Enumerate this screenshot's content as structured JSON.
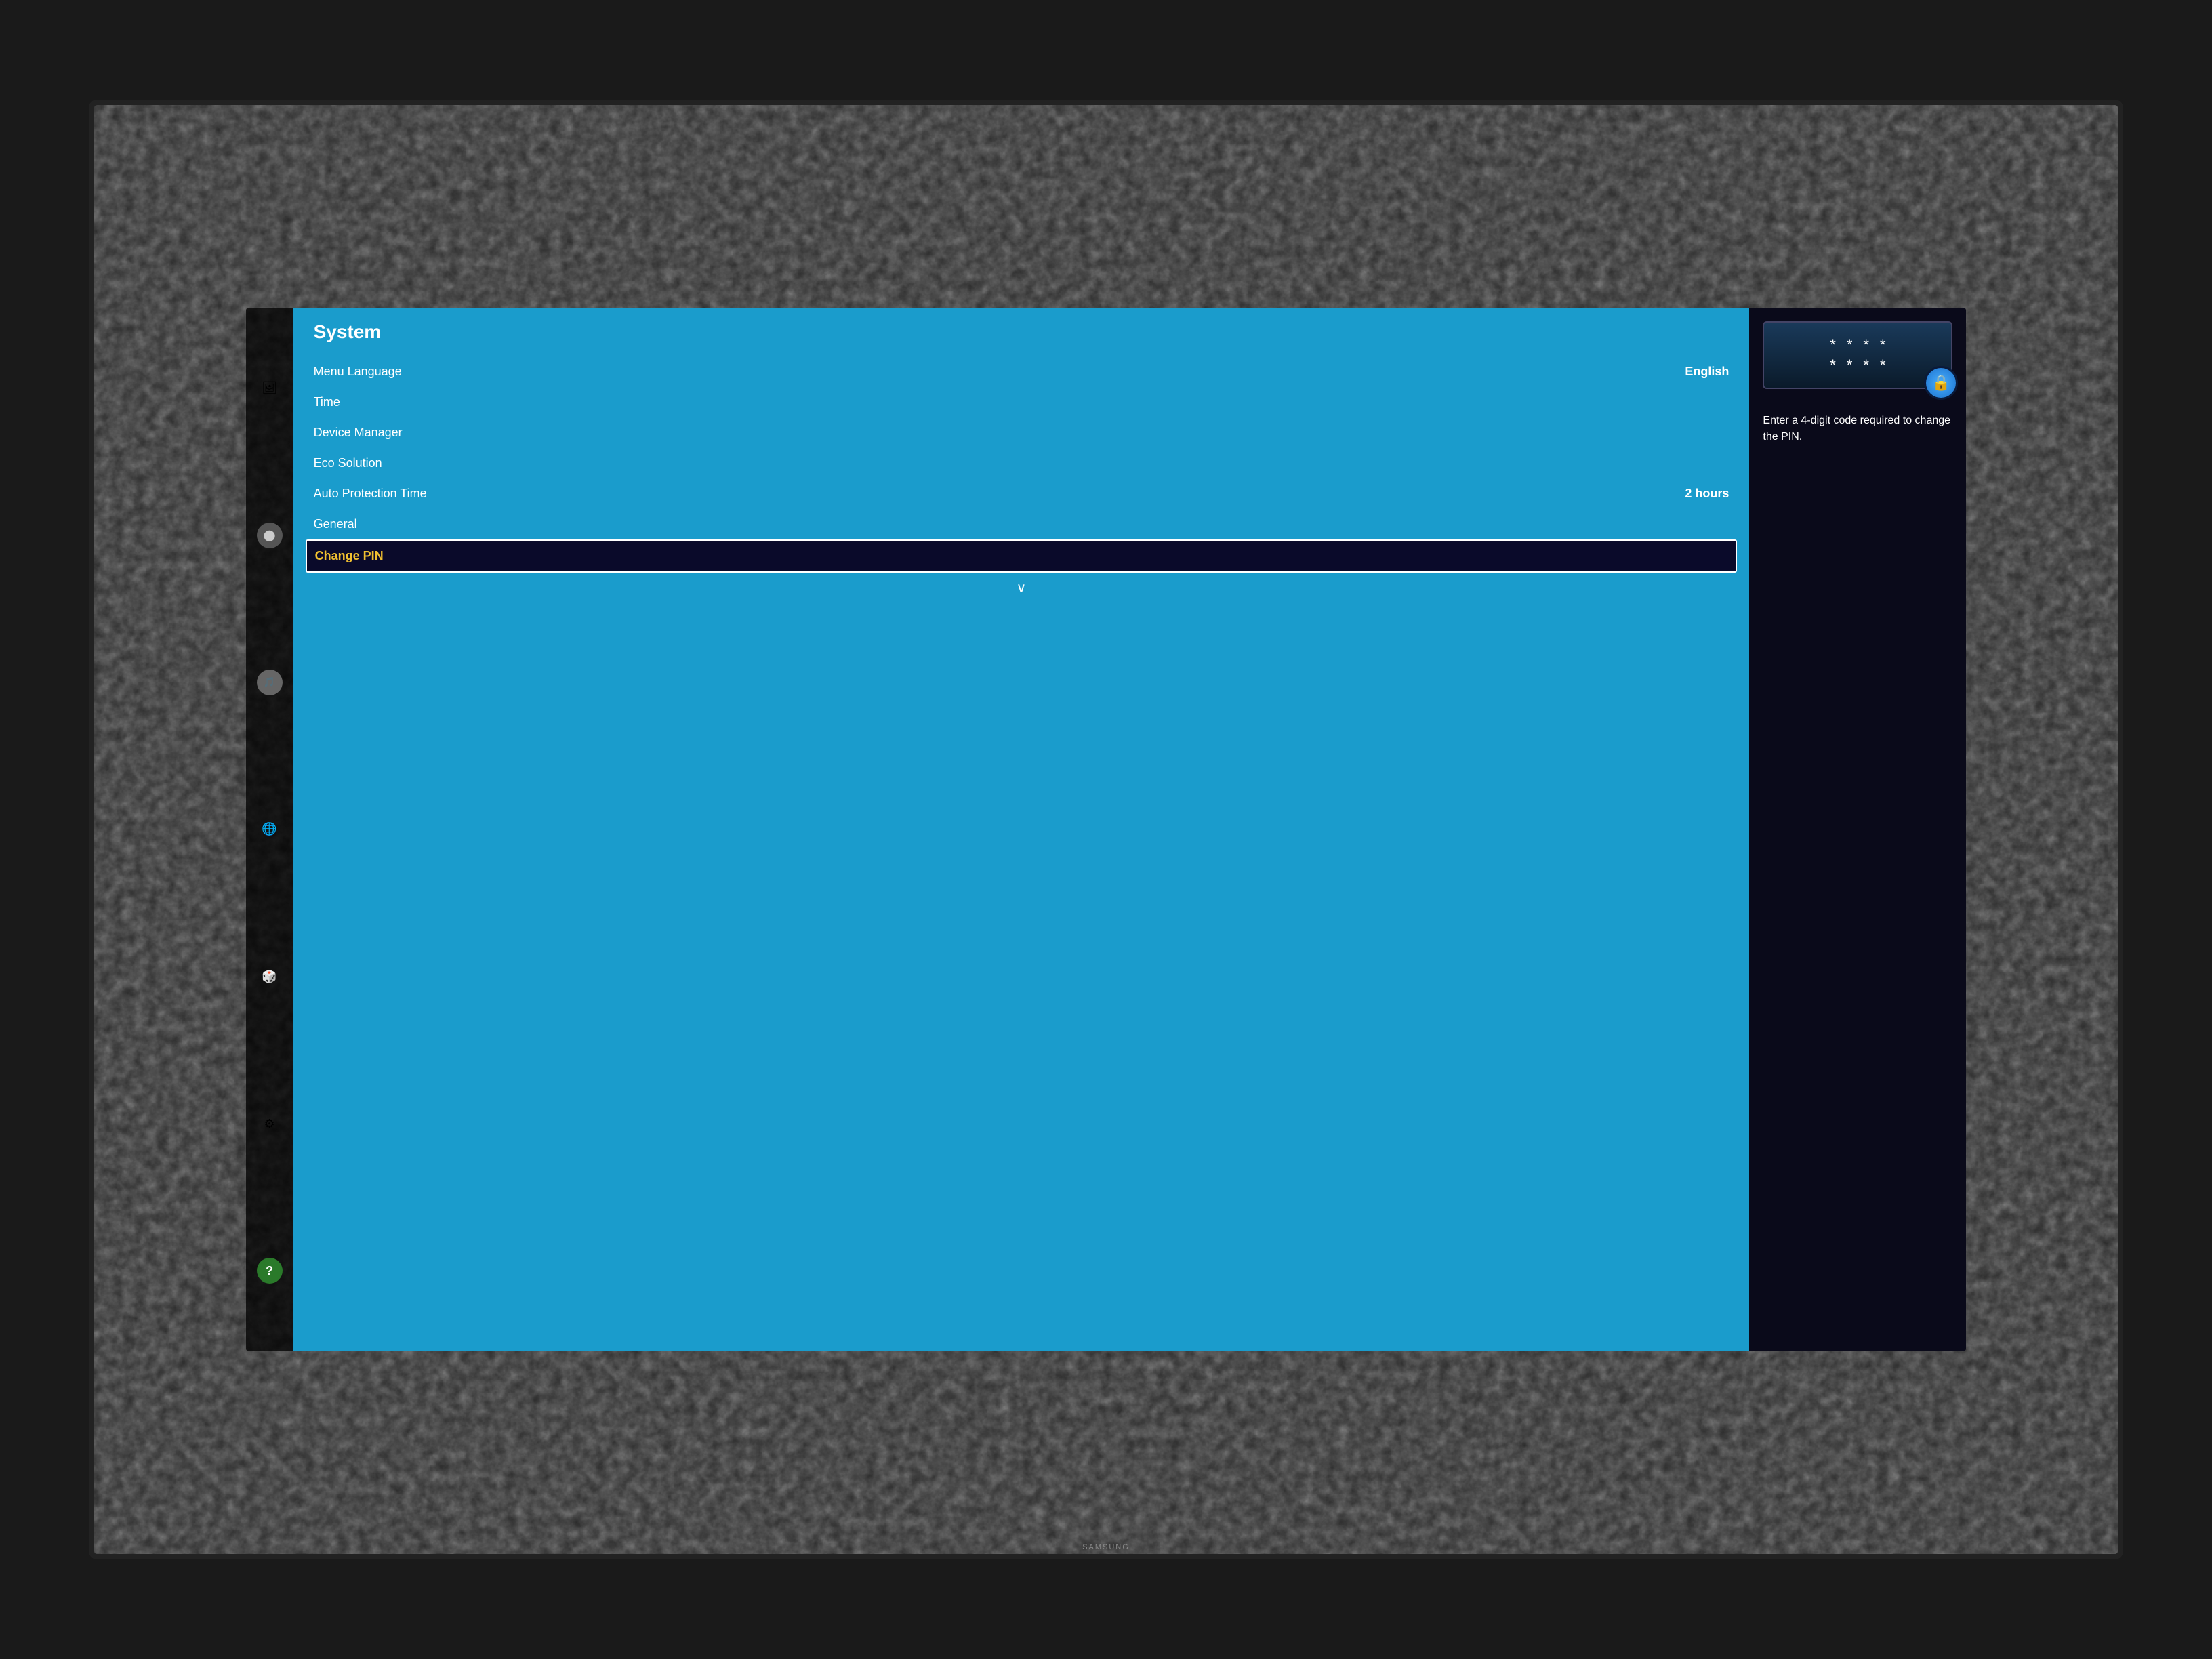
{
  "tv": {
    "brand": "SAMSUNG"
  },
  "sidebar": {
    "icons": [
      {
        "id": "photo-icon",
        "symbol": "🖼",
        "label": "photo"
      },
      {
        "id": "camera-icon",
        "symbol": "⬤",
        "label": "camera"
      },
      {
        "id": "audio-icon",
        "symbol": "🎵",
        "label": "audio"
      },
      {
        "id": "globe-icon",
        "symbol": "🌐",
        "label": "internet"
      },
      {
        "id": "app-icon",
        "symbol": "🎲",
        "label": "apps"
      },
      {
        "id": "settings-icon",
        "symbol": "⚙",
        "label": "settings"
      },
      {
        "id": "help-icon",
        "symbol": "?",
        "label": "help"
      }
    ]
  },
  "menu": {
    "title": "System",
    "items": [
      {
        "label": "Menu Language",
        "value": "English",
        "active": false
      },
      {
        "label": "Time",
        "value": "",
        "active": false
      },
      {
        "label": "Device Manager",
        "value": "",
        "active": false
      },
      {
        "label": "Eco Solution",
        "value": "",
        "active": false
      },
      {
        "label": "Auto Protection Time",
        "value": "2 hours",
        "active": false
      },
      {
        "label": "General",
        "value": "",
        "active": false
      },
      {
        "label": "Change PIN",
        "value": "",
        "active": true
      }
    ],
    "scroll_down": "∨"
  },
  "right_panel": {
    "pin_dots_row1": [
      "*",
      "*",
      "*",
      "*"
    ],
    "pin_dots_row2": [
      "*",
      "*",
      "*",
      "*"
    ],
    "description": "Enter a 4-digit code required to change the PIN.",
    "lock_symbol": "🔒"
  }
}
